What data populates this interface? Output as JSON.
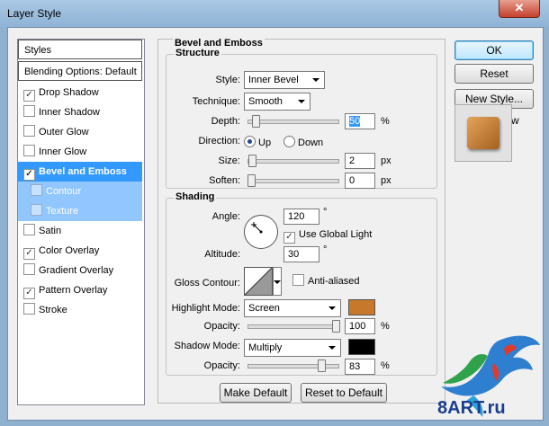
{
  "window": {
    "title": "Layer Style",
    "close_glyph": "✕"
  },
  "left_list": {
    "styles_header": "Styles",
    "blending_header": "Blending Options: Default",
    "items": [
      {
        "label": "Drop Shadow",
        "checked": true
      },
      {
        "label": "Inner Shadow",
        "checked": false
      },
      {
        "label": "Outer Glow",
        "checked": false
      },
      {
        "label": "Inner Glow",
        "checked": false
      },
      {
        "label": "Bevel and Emboss",
        "checked": true,
        "selected": true
      },
      {
        "label": "Contour",
        "checked": false,
        "sub": true
      },
      {
        "label": "Texture",
        "checked": false,
        "sub": true
      },
      {
        "label": "Satin",
        "checked": false
      },
      {
        "label": "Color Overlay",
        "checked": true
      },
      {
        "label": "Gradient Overlay",
        "checked": false
      },
      {
        "label": "Pattern Overlay",
        "checked": true
      },
      {
        "label": "Stroke",
        "checked": false
      }
    ]
  },
  "bevel": {
    "title": "Bevel and Emboss",
    "structure": {
      "title": "Structure",
      "style_label": "Style:",
      "style_value": "Inner Bevel",
      "technique_label": "Technique:",
      "technique_value": "Smooth",
      "depth_label": "Depth:",
      "depth_value": "50",
      "depth_unit": "%",
      "depth_level": 0.05,
      "direction_label": "Direction:",
      "direction_up": "Up",
      "direction_down": "Down",
      "direction_selected": "Up",
      "size_label": "Size:",
      "size_value": "2",
      "size_unit": "px",
      "size_level": 0.01,
      "soften_label": "Soften:",
      "soften_value": "0",
      "soften_unit": "px",
      "soften_level": 0.0
    },
    "shading": {
      "title": "Shading",
      "angle_label": "Angle:",
      "angle_value": "120",
      "angle_unit": "°",
      "global_light_label": "Use Global Light",
      "global_light_checked": true,
      "altitude_label": "Altitude:",
      "altitude_value": "30",
      "altitude_unit": "°",
      "gloss_contour_label": "Gloss Contour:",
      "anti_aliased_label": "Anti-aliased",
      "anti_aliased_checked": false,
      "highlight_mode_label": "Highlight Mode:",
      "highlight_mode_value": "Screen",
      "highlight_color": "#c8782a",
      "highlight_opacity_label": "Opacity:",
      "highlight_opacity_value": "100",
      "highlight_opacity_unit": "%",
      "highlight_opacity_level": 1.0,
      "shadow_mode_label": "Shadow Mode:",
      "shadow_mode_value": "Multiply",
      "shadow_color": "#000000",
      "shadow_opacity_label": "Opacity:",
      "shadow_opacity_value": "83",
      "shadow_opacity_unit": "%",
      "shadow_opacity_level": 0.83
    },
    "make_default_label": "Make Default",
    "reset_default_label": "Reset to Default"
  },
  "right": {
    "ok_label": "OK",
    "reset_label": "Reset",
    "new_style_label": "New Style...",
    "preview_label": "Preview",
    "preview_checked": true
  },
  "watermark": {
    "text": "8ART.ru"
  }
}
